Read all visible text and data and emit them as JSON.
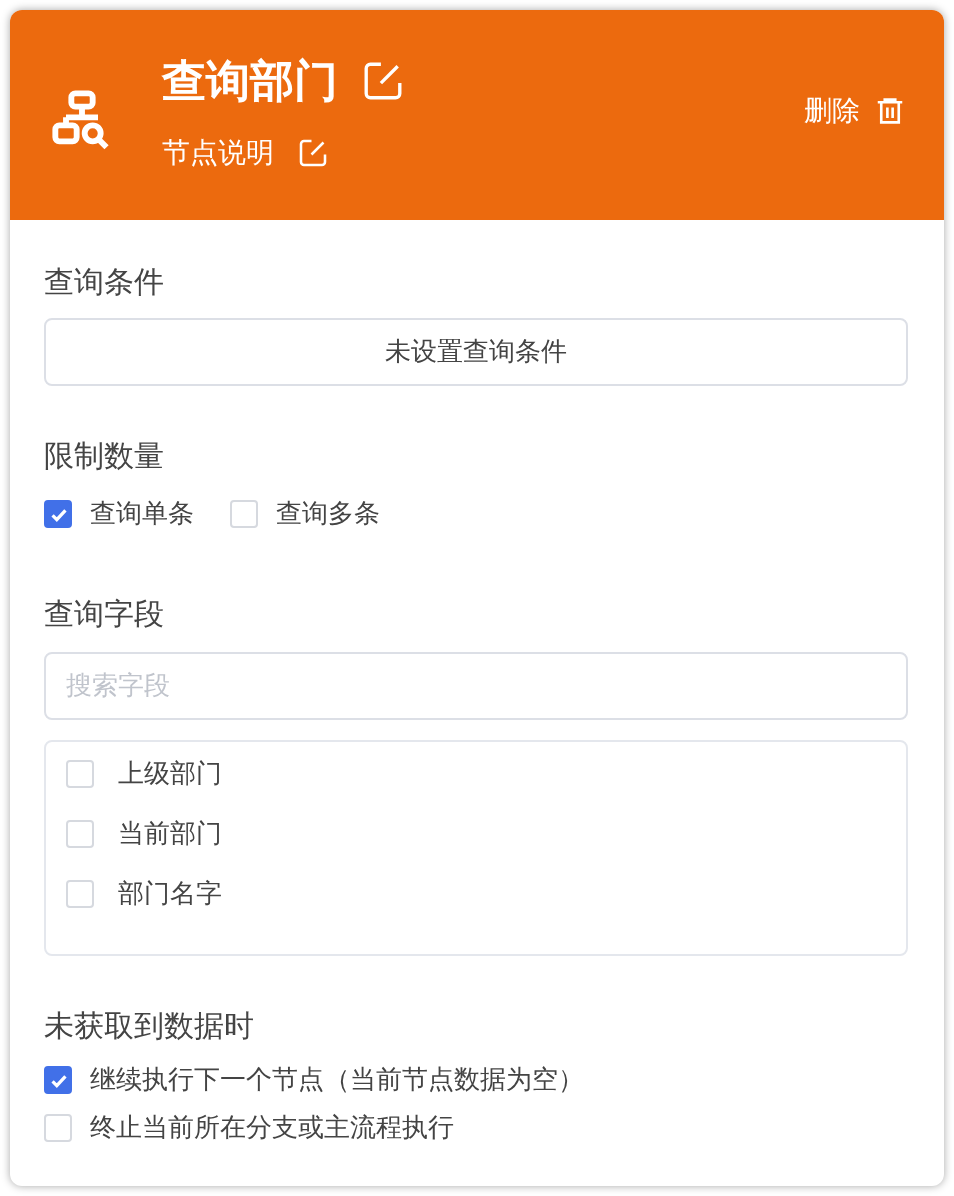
{
  "header": {
    "title": "查询部门",
    "description": "节点说明",
    "delete_label": "删除"
  },
  "query_conditions": {
    "label": "查询条件",
    "button": "未设置查询条件"
  },
  "limit": {
    "label": "限制数量",
    "options": [
      {
        "label": "查询单条",
        "checked": true
      },
      {
        "label": "查询多条",
        "checked": false
      }
    ]
  },
  "fields": {
    "label": "查询字段",
    "search": {
      "placeholder": "搜索字段"
    },
    "items": [
      {
        "label": "上级部门",
        "checked": false
      },
      {
        "label": "当前部门",
        "checked": false
      },
      {
        "label": "部门名字",
        "checked": false
      }
    ]
  },
  "no_data": {
    "label": "未获取到数据时",
    "options": [
      {
        "label": "继续执行下一个节点（当前节点数据为空）",
        "checked": true
      },
      {
        "label": "终止当前所在分支或主流程执行",
        "checked": false
      }
    ]
  }
}
